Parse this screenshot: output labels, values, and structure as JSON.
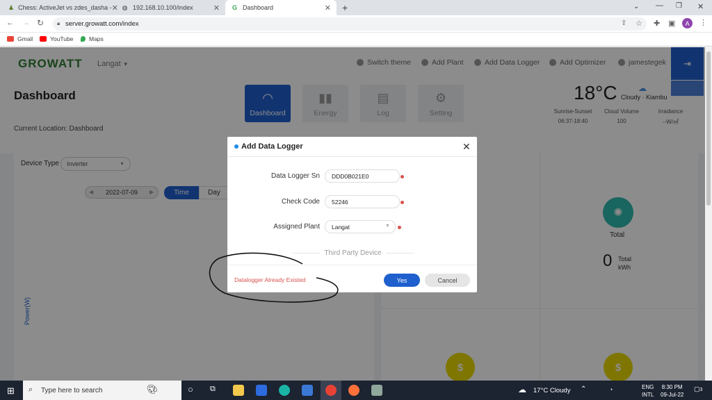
{
  "browser": {
    "tabs": [
      {
        "label": "Chess: ActiveJet vs zdes_dasha -"
      },
      {
        "label": "192.168.10.100/index"
      },
      {
        "label": "Dashboard"
      }
    ],
    "url": "server.growatt.com/index",
    "bookmarks": [
      "Gmail",
      "YouTube",
      "Maps"
    ],
    "profile_initial": "A"
  },
  "header": {
    "logo": "GROWATT",
    "plant": "Langat",
    "nav": [
      "Switch theme",
      "Add Plant",
      "Add Data Logger",
      "Add Optimizer",
      "jamestegek"
    ]
  },
  "dashboard": {
    "title": "Dashboard",
    "location": "Current Location: Dashboard",
    "tabs": [
      "Dashboard",
      "Energy",
      "Log",
      "Setting"
    ]
  },
  "weather": {
    "temp": "18°C",
    "desc": "Cloudy · Kiambu",
    "stats": [
      {
        "label": "Sunrise-Sunset",
        "value": "06:37-18:40"
      },
      {
        "label": "Cloud Volume",
        "value": "100"
      },
      {
        "label": "Irradiance",
        "value": "--W/㎡"
      }
    ]
  },
  "panel": {
    "device_type_label": "Device Type",
    "device_type_value": "Inverter",
    "date": "2022-07-09",
    "time_btn": "Time",
    "day_btn": "Day",
    "ylabel": "Power(W)",
    "total_label": "Total",
    "total_value": "0",
    "total_unit_1": "Total",
    "total_unit_2": "kWh"
  },
  "modal": {
    "title": "Add Data Logger",
    "fields": [
      {
        "label": "Data Logger Sn",
        "value": "DDD0B021E0"
      },
      {
        "label": "Check Code",
        "value": "52246"
      },
      {
        "label": "Assigned Plant",
        "value": "Langat"
      }
    ],
    "section": "Third Party Device",
    "error": "Datalogger Already Existed",
    "yes": "Yes",
    "cancel": "Cancel"
  },
  "taskbar": {
    "search_placeholder": "Type here to search",
    "weather": "17°C  Cloudy",
    "lang1": "ENG",
    "lang2": "INTL",
    "time": "8:30 PM",
    "date": "09-Jul-22",
    "notifications": "3"
  }
}
